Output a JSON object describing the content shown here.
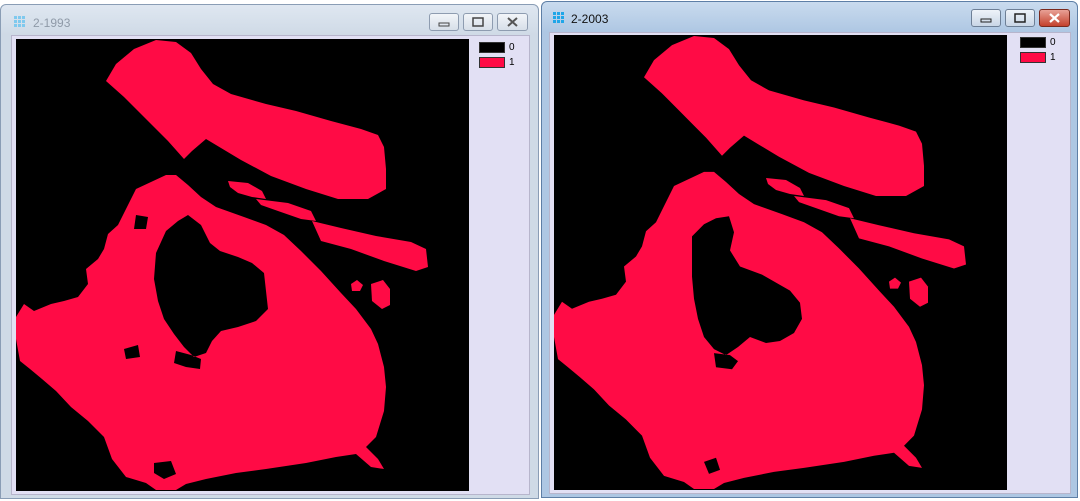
{
  "colors": {
    "class_0": "#000000",
    "class_1": "#ff0b45",
    "client_bg": "#e2e0f4",
    "close_active": "#c4412c"
  },
  "windows": [
    {
      "title": "2-1993",
      "state": "inactive",
      "icon": "raster-grid-icon",
      "controls": [
        "minimize-icon",
        "restore-icon",
        "close-icon"
      ],
      "legend": [
        {
          "value": "0",
          "color": "#000000"
        },
        {
          "value": "1",
          "color": "#ff0b45"
        }
      ]
    },
    {
      "title": "2-2003",
      "state": "active",
      "icon": "raster-grid-icon",
      "controls": [
        "minimize-icon",
        "restore-icon",
        "close-icon"
      ],
      "legend": [
        {
          "value": "0",
          "color": "#000000"
        },
        {
          "value": "1",
          "color": "#ff0b45"
        }
      ]
    }
  ]
}
